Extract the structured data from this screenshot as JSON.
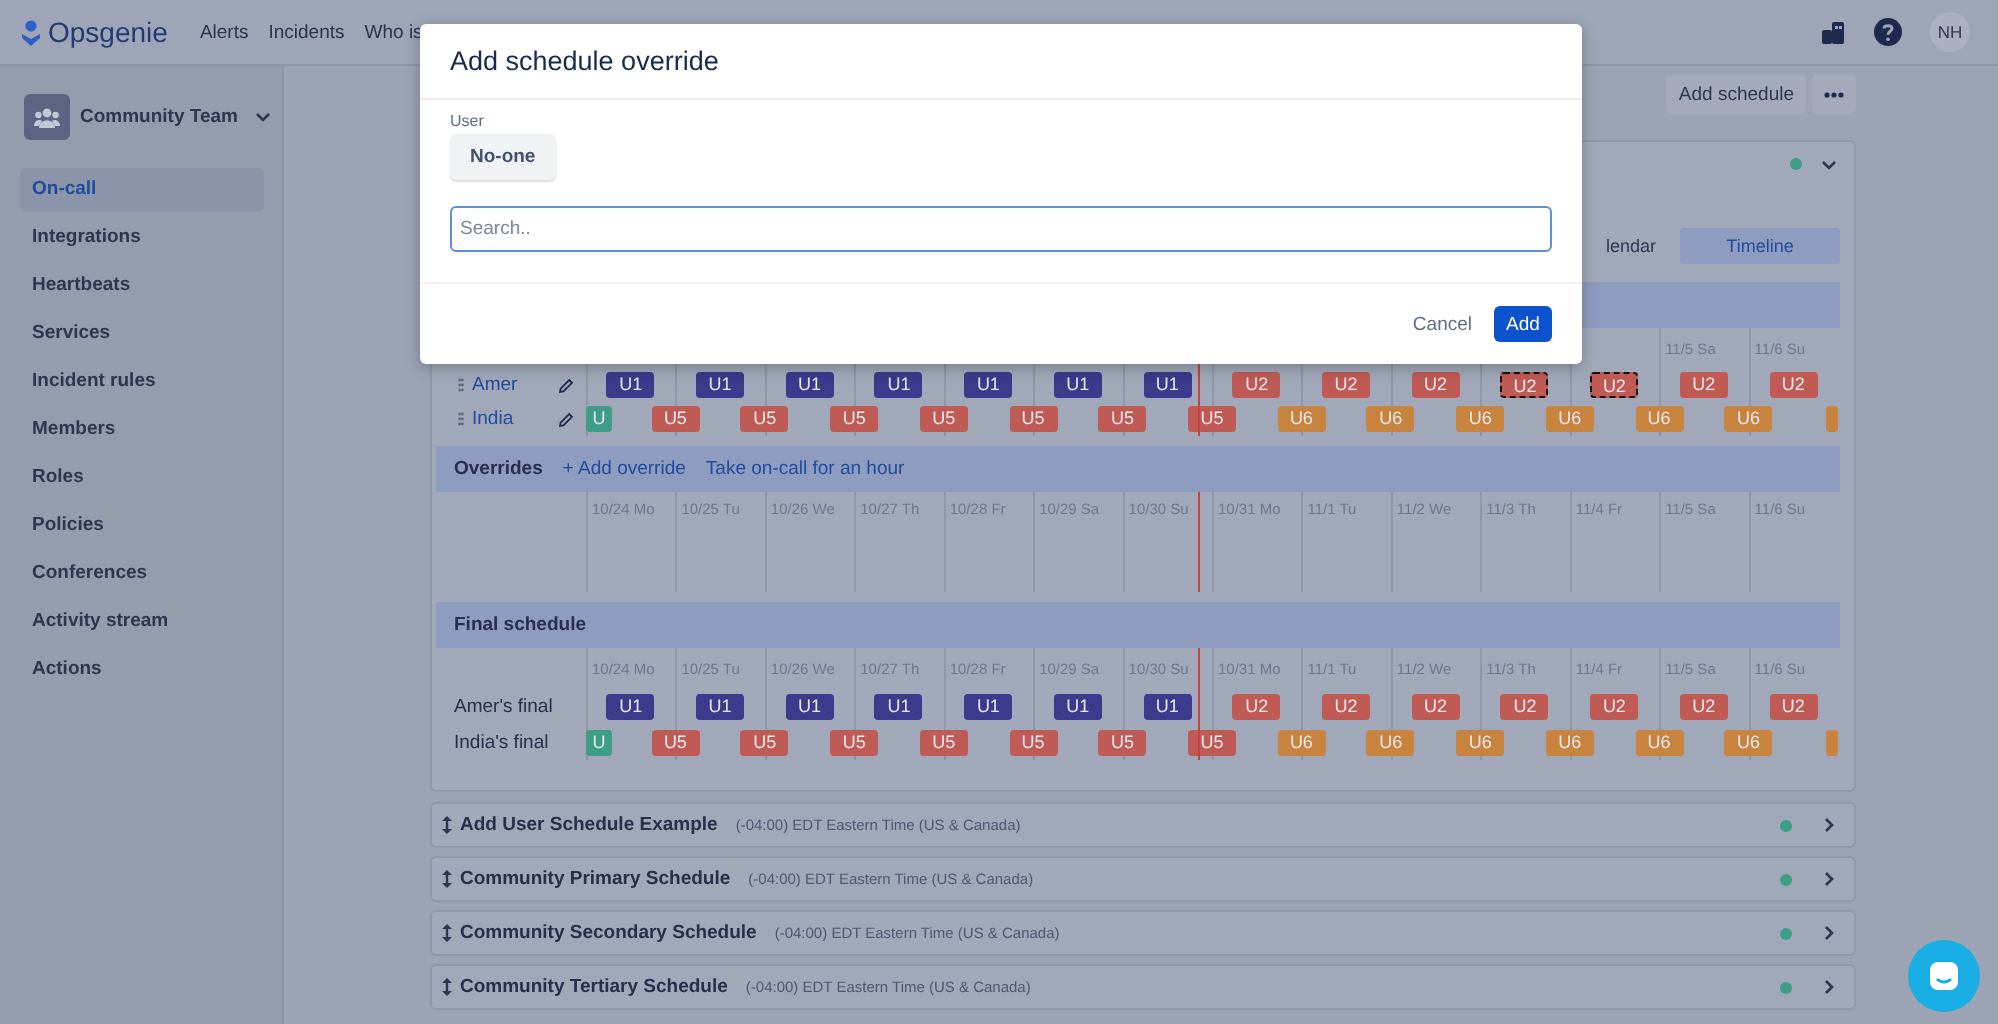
{
  "topbar": {
    "logo": "Opsgenie",
    "nav": [
      "Alerts",
      "Incidents",
      "Who is"
    ],
    "avatar": "NH"
  },
  "sidebar": {
    "team": "Community Team",
    "items": [
      {
        "label": "On-call",
        "selected": true
      },
      {
        "label": "Integrations",
        "selected": false
      },
      {
        "label": "Heartbeats",
        "selected": false
      },
      {
        "label": "Services",
        "selected": false
      },
      {
        "label": "Incident rules",
        "selected": false
      },
      {
        "label": "Members",
        "selected": false
      },
      {
        "label": "Roles",
        "selected": false
      },
      {
        "label": "Policies",
        "selected": false
      },
      {
        "label": "Conferences",
        "selected": false
      },
      {
        "label": "Activity stream",
        "selected": false
      },
      {
        "label": "Actions",
        "selected": false
      }
    ]
  },
  "toolbar": {
    "add_schedule": "Add schedule"
  },
  "schedule_card": {
    "expanded": true,
    "view_tabs": [
      {
        "label": "lendar",
        "selected": false
      },
      {
        "label": "Timeline",
        "selected": true
      }
    ],
    "rotation": {
      "dates": [
        "11/5 Sa",
        "11/6 Su"
      ],
      "rows": [
        {
          "name": "Amer",
          "kind": "aligned",
          "chips": [
            {
              "label": "U1",
              "color": "#3b3a8c",
              "kind": "full",
              "selected": false
            },
            {
              "label": "U1",
              "color": "#3b3a8c",
              "kind": "full",
              "selected": false
            },
            {
              "label": "U1",
              "color": "#3b3a8c",
              "kind": "full",
              "selected": false
            },
            {
              "label": "U1",
              "color": "#3b3a8c",
              "kind": "full",
              "selected": false
            },
            {
              "label": "U1",
              "color": "#3b3a8c",
              "kind": "full",
              "selected": false
            },
            {
              "label": "U1",
              "color": "#3b3a8c",
              "kind": "full",
              "selected": false
            },
            {
              "label": "U1",
              "color": "#3b3a8c",
              "kind": "full",
              "selected": false
            },
            {
              "label": "U2",
              "color": "#c05a55",
              "kind": "full",
              "selected": false
            },
            {
              "label": "U2",
              "color": "#c05a55",
              "kind": "full",
              "selected": false
            },
            {
              "label": "U2",
              "color": "#c05a55",
              "kind": "full",
              "selected": false
            },
            {
              "label": "U2",
              "color": "#c05a55",
              "kind": "full",
              "selected": true
            },
            {
              "label": "U2",
              "color": "#c05a55",
              "kind": "full",
              "selected": true
            },
            {
              "label": "U2",
              "color": "#c05a55",
              "kind": "full",
              "selected": false
            },
            {
              "label": "U2",
              "color": "#c05a55",
              "kind": "full",
              "selected": false
            }
          ]
        },
        {
          "name": "India",
          "kind": "shifted",
          "chips": [
            {
              "label": "U",
              "color": "#3e9d86",
              "kind": "start",
              "selected": false
            },
            {
              "label": "U5",
              "color": "#c05a55",
              "kind": "full",
              "selected": false
            },
            {
              "label": "U5",
              "color": "#c05a55",
              "kind": "full",
              "selected": false
            },
            {
              "label": "U5",
              "color": "#c05a55",
              "kind": "full",
              "selected": false
            },
            {
              "label": "U5",
              "color": "#c05a55",
              "kind": "full",
              "selected": false
            },
            {
              "label": "U5",
              "color": "#c05a55",
              "kind": "full",
              "selected": false
            },
            {
              "label": "U5",
              "color": "#c05a55",
              "kind": "full",
              "selected": false
            },
            {
              "label": "U5",
              "color": "#c05a55",
              "kind": "full",
              "selected": false
            },
            {
              "label": "U6",
              "color": "#c8843f",
              "kind": "full",
              "selected": false
            },
            {
              "label": "U6",
              "color": "#c8843f",
              "kind": "full",
              "selected": false
            },
            {
              "label": "U6",
              "color": "#c8843f",
              "kind": "full",
              "selected": false
            },
            {
              "label": "U6",
              "color": "#c8843f",
              "kind": "full",
              "selected": false
            },
            {
              "label": "U6",
              "color": "#c8843f",
              "kind": "full",
              "selected": false
            },
            {
              "label": "U6",
              "color": "#c8843f",
              "kind": "full",
              "selected": false
            },
            {
              "color": "#c8843f",
              "kind": "end",
              "selected": false
            }
          ]
        }
      ]
    },
    "overrides": {
      "title": "Overrides",
      "links": [
        "+ Add override",
        "Take on-call for an hour"
      ],
      "dates": [
        "10/24 Mo",
        "10/25 Tu",
        "10/26 We",
        "10/27 Th",
        "10/28 Fr",
        "10/29 Sa",
        "10/30 Su",
        "10/31 Mo",
        "11/1 Tu",
        "11/2 We",
        "11/3 Th",
        "11/4 Fr",
        "11/5 Sa",
        "11/6 Su"
      ]
    },
    "final": {
      "title": "Final schedule",
      "dates": [
        "10/24 Mo",
        "10/25 Tu",
        "10/26 We",
        "10/27 Th",
        "10/28 Fr",
        "10/29 Sa",
        "10/30 Su",
        "10/31 Mo",
        "11/1 Tu",
        "11/2 We",
        "11/3 Th",
        "11/4 Fr",
        "11/5 Sa",
        "11/6 Su"
      ],
      "rows": [
        {
          "name": "Amer's final",
          "kind": "aligned",
          "chips": [
            {
              "label": "U1",
              "color": "#3b3a8c",
              "kind": "full"
            },
            {
              "label": "U1",
              "color": "#3b3a8c",
              "kind": "full"
            },
            {
              "label": "U1",
              "color": "#3b3a8c",
              "kind": "full"
            },
            {
              "label": "U1",
              "color": "#3b3a8c",
              "kind": "full"
            },
            {
              "label": "U1",
              "color": "#3b3a8c",
              "kind": "full"
            },
            {
              "label": "U1",
              "color": "#3b3a8c",
              "kind": "full"
            },
            {
              "label": "U1",
              "color": "#3b3a8c",
              "kind": "full"
            },
            {
              "label": "U2",
              "color": "#c05a55",
              "kind": "full"
            },
            {
              "label": "U2",
              "color": "#c05a55",
              "kind": "full"
            },
            {
              "label": "U2",
              "color": "#c05a55",
              "kind": "full"
            },
            {
              "label": "U2",
              "color": "#c05a55",
              "kind": "full"
            },
            {
              "label": "U2",
              "color": "#c05a55",
              "kind": "full"
            },
            {
              "label": "U2",
              "color": "#c05a55",
              "kind": "full"
            },
            {
              "label": "U2",
              "color": "#c05a55",
              "kind": "full"
            }
          ]
        },
        {
          "name": "India's final",
          "kind": "shifted",
          "chips": [
            {
              "label": "U",
              "color": "#3e9d86",
              "kind": "start"
            },
            {
              "label": "U5",
              "color": "#c05a55",
              "kind": "full"
            },
            {
              "label": "U5",
              "color": "#c05a55",
              "kind": "full"
            },
            {
              "label": "U5",
              "color": "#c05a55",
              "kind": "full"
            },
            {
              "label": "U5",
              "color": "#c05a55",
              "kind": "full"
            },
            {
              "label": "U5",
              "color": "#c05a55",
              "kind": "full"
            },
            {
              "label": "U5",
              "color": "#c05a55",
              "kind": "full"
            },
            {
              "label": "U5",
              "color": "#c05a55",
              "kind": "full"
            },
            {
              "label": "U6",
              "color": "#c8843f",
              "kind": "full"
            },
            {
              "label": "U6",
              "color": "#c8843f",
              "kind": "full"
            },
            {
              "label": "U6",
              "color": "#c8843f",
              "kind": "full"
            },
            {
              "label": "U6",
              "color": "#c8843f",
              "kind": "full"
            },
            {
              "label": "U6",
              "color": "#c8843f",
              "kind": "full"
            },
            {
              "label": "U6",
              "color": "#c8843f",
              "kind": "full"
            },
            {
              "color": "#c8843f",
              "kind": "end"
            }
          ]
        }
      ]
    }
  },
  "schedules": [
    {
      "name": "Add User Schedule Example",
      "timezone": "(-04:00) EDT Eastern Time (US & Canada)",
      "expanded": false
    },
    {
      "name": "Community Primary Schedule",
      "timezone": "(-04:00) EDT Eastern Time (US & Canada)",
      "expanded": false
    },
    {
      "name": "Community Secondary Schedule",
      "timezone": "(-04:00) EDT Eastern Time (US & Canada)",
      "expanded": false
    },
    {
      "name": "Community Tertiary Schedule",
      "timezone": "(-04:00) EDT Eastern Time (US & Canada)",
      "expanded": false
    }
  ],
  "modal": {
    "title": "Add schedule override",
    "user_label": "User",
    "user_value": "No-one",
    "search": {
      "placeholder": "Search.."
    },
    "cancel": "Cancel",
    "add": "Add"
  }
}
